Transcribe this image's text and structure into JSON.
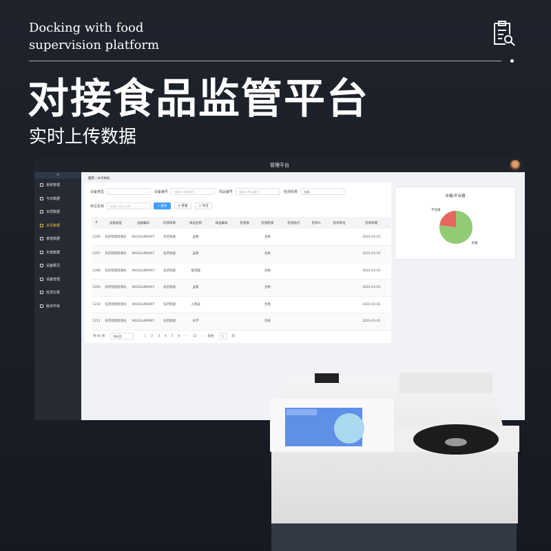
{
  "hero": {
    "english": [
      "Docking with food",
      "supervision platform"
    ],
    "title": "对接食品监管平台",
    "subtitle": "实时上传数据",
    "icon": "clipboard-search-icon"
  },
  "app": {
    "title": "管理平台",
    "sidebar": [
      {
        "label": "系统管理"
      },
      {
        "label": "今日数据"
      },
      {
        "label": "本周数据"
      },
      {
        "label": "本月数据",
        "active": true
      },
      {
        "label": "季度数据"
      },
      {
        "label": "年度数据"
      },
      {
        "label": "设备概况"
      },
      {
        "label": "设备管理"
      },
      {
        "label": "检测记录"
      },
      {
        "label": "版本升级"
      }
    ],
    "breadcrumb": [
      "首页",
      "本月数据"
    ],
    "filters": {
      "device_type": "设备类型",
      "device_no": "设备编号",
      "device_no_ph": "请输入设备编号",
      "sample_no": "样品编号",
      "sample_no_ph": "请输入样品编号",
      "result": "检测结果",
      "result_value": "全部",
      "unit": "单位名称",
      "unit_ph": "请输入单位名称"
    },
    "buttons": {
      "search": "查询",
      "reset": "重置",
      "export": "导出"
    },
    "columns": [
      "#",
      "设备类型",
      "设备编号",
      "检测项目",
      "样品名称",
      "样品编号",
      "检测值",
      "检测结果",
      "检测地点",
      "检测人",
      "检测单位",
      "检测日期"
    ],
    "rows": [
      [
        "1206",
        "农药残留检测仪",
        "90202af80907",
        "农药残留",
        "韭黄",
        "",
        "",
        "合格",
        "",
        "",
        "",
        "2022-03-01"
      ],
      [
        "1207",
        "农药残留检测仪",
        "90202af80907",
        "农药残留",
        "韭黄",
        "",
        "",
        "合格",
        "",
        "",
        "",
        "2022-03-01"
      ],
      [
        "1208",
        "农药残留检测仪",
        "90202af80907",
        "农药残留",
        "菊花脑",
        "",
        "",
        "合格",
        "",
        "",
        "",
        "2022-03-01"
      ],
      [
        "1209",
        "农药残留检测仪",
        "90202af80907",
        "农药残留",
        "韭黄",
        "",
        "",
        "合格",
        "",
        "",
        "",
        "2022-03-01"
      ],
      [
        "1210",
        "农药残留检测仪",
        "90202af80907",
        "农药残留",
        "小香菜",
        "",
        "",
        "合格",
        "",
        "",
        "",
        "2022-03-01"
      ],
      [
        "1211",
        "农药残留检测仪",
        "90202af80907",
        "农药残留",
        "水芹",
        "",
        "",
        "合格",
        "",
        "",
        "",
        "2022-03-01"
      ]
    ],
    "pagination": {
      "total": "共 65 条",
      "size": "6条/页",
      "pages": [
        "1",
        "2",
        "3",
        "4",
        "5",
        "6",
        "···",
        "11"
      ],
      "current": "1",
      "goto": "前往",
      "goto_value": "1",
      "page_unit": "页"
    }
  },
  "chart_data": {
    "type": "pie",
    "title": "合格/不合格",
    "labels": [
      "合格",
      "不合格"
    ],
    "values": [
      77,
      23
    ],
    "colors": [
      "#91cc75",
      "#e5675f"
    ]
  }
}
